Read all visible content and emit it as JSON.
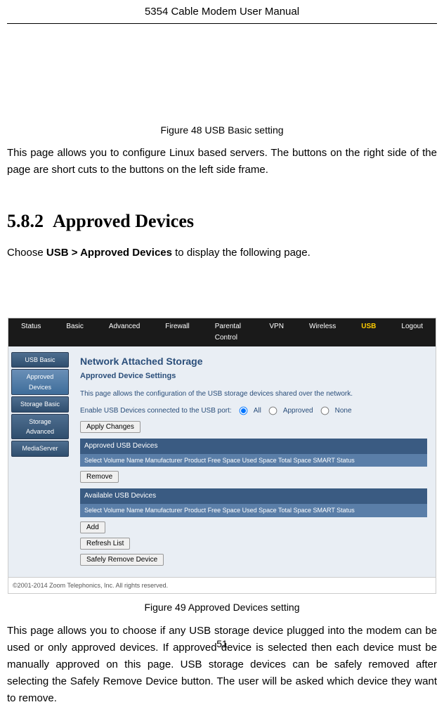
{
  "header": {
    "title": "5354 Cable Modem User Manual"
  },
  "figure48": {
    "caption": "Figure 48 USB Basic setting"
  },
  "para1": "This page allows you to configure Linux based servers. The buttons on the right side of the page are short cuts to the buttons on the left side frame.",
  "section": {
    "number": "5.8.2",
    "title": "Approved Devices"
  },
  "para2_pre": "Choose ",
  "para2_bold": "USB > Approved Devices",
  "para2_post": " to display the following page.",
  "screenshot": {
    "topnav": {
      "status": "Status",
      "basic": "Basic",
      "advanced": "Advanced",
      "firewall": "Firewall",
      "parental": "Parental Control",
      "vpn": "VPN",
      "wireless": "Wireless",
      "usb": "USB",
      "logout": "Logout"
    },
    "sidebar": {
      "usb_basic": "USB Basic",
      "approved": "Approved Devices",
      "storage_basic": "Storage Basic",
      "storage_adv": "Storage Advanced",
      "media": "MediaServer"
    },
    "content": {
      "title": "Network Attached Storage",
      "subtitle": "Approved Device Settings",
      "desc": "This page allows the configuration of the USB storage devices shared over the network.",
      "enable_label": "Enable USB Devices connected to the USB port:",
      "opt_all": "All",
      "opt_approved": "Approved",
      "opt_none": "None",
      "apply": "Apply Changes",
      "approved_header": "Approved USB Devices",
      "table_cols": "Select Volume Name Manufacturer Product Free Space Used Space Total Space SMART Status",
      "remove": "Remove",
      "available_header": "Available USB Devices",
      "add": "Add",
      "refresh": "Refresh List",
      "safely_remove": "Safely Remove Device"
    },
    "copyright": "©2001-2014 Zoom Telephonics, Inc. All rights reserved."
  },
  "figure49": {
    "caption": "Figure 49 Approved Devices setting"
  },
  "para3": "This page allows you to choose if any USB storage device plugged into the modem can be used or only approved devices. If approved device is selected then each device must be manually approved on this page. USB storage devices can be safely removed after selecting the Safely Remove Device button. The user will be asked which device they want to remove.",
  "page_number": "51"
}
